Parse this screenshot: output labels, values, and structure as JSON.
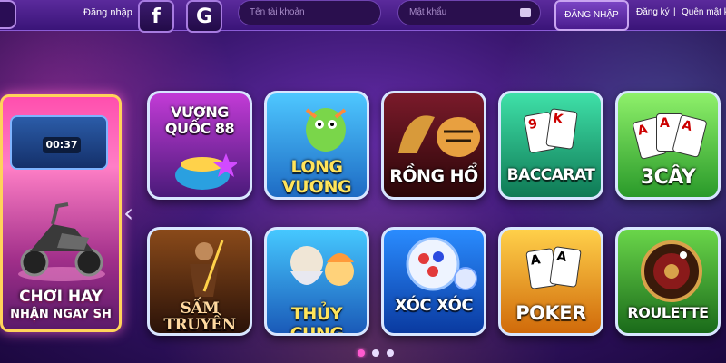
{
  "topbar": {
    "login_link": "Đăng nhập",
    "facebook_glyph": "f",
    "google_glyph": "G",
    "username_placeholder": "Tên tài khoản",
    "password_placeholder": "Mật khẩu",
    "login_button": "ĐĂNG NHẬP",
    "register_link": "Đăng ký",
    "separator": "|",
    "forgot_link": "Quên mật k"
  },
  "promo": {
    "timer": "00:37",
    "line1": "CHƠI HAY",
    "line2": "NHẬN NGAY SH"
  },
  "nav": {
    "prev_arrow": "‹"
  },
  "games": [
    {
      "label": "VƯƠNG QUỐC 88"
    },
    {
      "label": "LONG VƯƠNG"
    },
    {
      "label": "RỒNG HỔ"
    },
    {
      "label": "BACCARAT"
    },
    {
      "label": "3CÂY"
    },
    {
      "label": "SẤM TRUYỀN"
    },
    {
      "label": "THỦY CUNG"
    },
    {
      "label": "XÓC XÓC"
    },
    {
      "label": "POKER"
    },
    {
      "label": "ROULETTE"
    }
  ],
  "cards": {
    "baccarat": [
      "9",
      "K"
    ],
    "three_cay": [
      "A",
      "A",
      "A"
    ],
    "poker": [
      "A",
      "A"
    ]
  },
  "pagination": {
    "count": 3,
    "active": 0
  },
  "colors": {
    "accent": "#ff5ad0",
    "bar": "#3a1478"
  }
}
